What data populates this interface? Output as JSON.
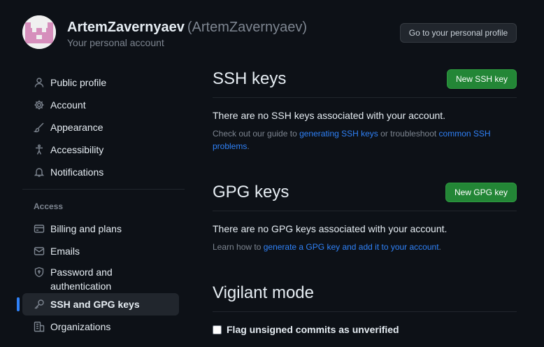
{
  "header": {
    "name": "ArtemZavernyaev",
    "login": "(ArtemZavernyaev)",
    "subtitle": "Your personal account",
    "profile_button": "Go to your personal profile"
  },
  "sidebar": {
    "items": [
      {
        "label": "Public profile",
        "icon": "person-icon"
      },
      {
        "label": "Account",
        "icon": "gear-icon"
      },
      {
        "label": "Appearance",
        "icon": "paintbrush-icon"
      },
      {
        "label": "Accessibility",
        "icon": "accessibility-icon"
      },
      {
        "label": "Notifications",
        "icon": "bell-icon"
      }
    ],
    "access_heading": "Access",
    "access_items": [
      {
        "label": "Billing and plans",
        "icon": "credit-card-icon"
      },
      {
        "label": "Emails",
        "icon": "mail-icon"
      },
      {
        "label": "Password and authentication",
        "icon": "shield-lock-icon"
      },
      {
        "label": "SSH and GPG keys",
        "icon": "key-icon",
        "active": true
      },
      {
        "label": "Organizations",
        "icon": "organization-icon"
      }
    ]
  },
  "ssh": {
    "title": "SSH keys",
    "button": "New SSH key",
    "empty": "There are no SSH keys associated with your account.",
    "help_prefix": "Check out our guide to ",
    "help_link1": "generating SSH keys",
    "help_middle": " or troubleshoot ",
    "help_link2": "common SSH problems",
    "help_suffix": "."
  },
  "gpg": {
    "title": "GPG keys",
    "button": "New GPG key",
    "empty": "There are no GPG keys associated with your account.",
    "help_prefix": "Learn how to ",
    "help_link": "generate a GPG key and add it to your account",
    "help_suffix": "."
  },
  "vigilant": {
    "title": "Vigilant mode",
    "checkbox_label": "Flag unsigned commits as unverified",
    "checked": false
  },
  "colors": {
    "background": "#0d1117",
    "accent_link": "#2f81f7",
    "green_button": "#238636"
  }
}
